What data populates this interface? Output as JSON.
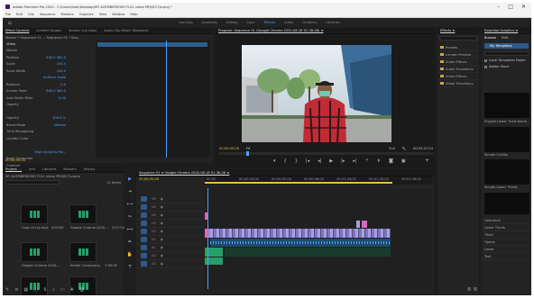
{
  "app": {
    "title": "Adobe Premiere Pro 2020 - C:\\Users\\User\\Desktop\\MY ACEMBERSOKO FULL video PROJECT.prproj *",
    "win_buttons": [
      "–",
      "□",
      "✕"
    ]
  },
  "menu": [
    "File",
    "Edit",
    "Clip",
    "Sequence",
    "Markers",
    "Graphics",
    "View",
    "Window",
    "Help"
  ],
  "workspaces": [
    "Learning",
    "Assembly",
    "Editing",
    "Color",
    "Effects",
    "Audio",
    "Graphics",
    "Libraries"
  ],
  "workspace_active": 4,
  "effect_controls": {
    "tabs": [
      "Effect Controls",
      "Lumetri Scopes",
      "Source: (no clips)",
      "Audio Clip Mixer: Sequence"
    ],
    "master": "Master * Sequence 01 ... Sequence 01 * Seq...",
    "clip_label": "Video",
    "rows": [
      {
        "label": "Motion",
        "value": ""
      },
      {
        "label": "Position",
        "value": "640.0  360.0"
      },
      {
        "label": "Scale",
        "value": "100.0"
      },
      {
        "label": "Scale Width",
        "value": "100.0"
      },
      {
        "label": "",
        "value": "Uniform Scale"
      },
      {
        "label": "Rotation",
        "value": "0.0"
      },
      {
        "label": "Anchor Point",
        "value": "640.0  360.0"
      },
      {
        "label": "Anti-flicker Filter",
        "value": "0.00"
      },
      {
        "label": "Opacity",
        "value": ""
      },
      {
        "label": "",
        "value": ""
      },
      {
        "label": "Opacity",
        "value": "100.0 %"
      },
      {
        "label": "Blend Mode",
        "value": "Normal"
      },
      {
        "label": "Time Remapping",
        "value": ""
      },
      {
        "label": "Lumetri Color",
        "value": ""
      },
      {
        "label": "",
        "value": ""
      },
      {
        "label": "",
        "value": "High Dynamic Ra..."
      },
      {
        "label": "Basic Correction",
        "value": ""
      },
      {
        "label": "Creative",
        "value": ""
      },
      {
        "label": "Curves",
        "value": ""
      }
    ],
    "timecode": "00;00;00;00"
  },
  "program": {
    "title": "Program: Sequence 01 (Google Chrome 2020-08-18 01-36-08) ≡",
    "timecode": "00;00;05;28",
    "fit": "Fit",
    "quality": "Full",
    "duration": "00;03;27;24",
    "controls": [
      "marker",
      "in",
      "out",
      "go-in",
      "step-back",
      "play",
      "step-fwd",
      "go-out",
      "lift",
      "extract",
      "export-frame",
      "settings"
    ]
  },
  "project": {
    "tabs": [
      "Project: ...",
      "Info",
      "Libraries",
      "Markers",
      "History"
    ],
    "active_tab": 0,
    "path": "MY ACEMBERSOKO FULL video PROJECT.prproj",
    "count": "22 Items",
    "items": [
      {
        "name": "Copy of Lily.mp4",
        "dur": "5:00:00"
      },
      {
        "name": "Google Chrome 2020-...",
        "dur": "3:27:24"
      },
      {
        "name": "Google Chrome 2020-...",
        "dur": ""
      },
      {
        "name": "Action Conspiracy...",
        "dur": "3:00:00"
      },
      {
        "name": "MPA4_google_...",
        "dur": "3:37:31"
      },
      {
        "name": "",
        "dur": ""
      }
    ]
  },
  "timeline": {
    "title": "Sequence 01 ≡ Google Chrome 2020-08-18 01-36-08  ≡",
    "timecode": "00;00;05;28",
    "ruler": [
      "00;00",
      "00;00;16;00",
      "00;00;32;00",
      "00;00;48;00",
      "00;01;04;02",
      "00;01;20;02",
      "00;01;36;02"
    ],
    "tracks": [
      "V6",
      "V5",
      "V4",
      "V3",
      "V2",
      "V1",
      "A1",
      "A2",
      "A3"
    ]
  },
  "tools": [
    "selection",
    "track-select",
    "ripple",
    "razor",
    "slip",
    "pen",
    "hand",
    "type"
  ],
  "effects": {
    "title": "Effects ≡",
    "search": "",
    "items": [
      "Presets",
      "Lumetri Presets",
      "Audio Effects",
      "Audio Transitions",
      "Video Effects",
      "Video Transitions"
    ]
  },
  "essential": {
    "title": "Essential Graphics ≡",
    "tabs": [
      "Browse",
      "Edit"
    ],
    "section": "My Templates",
    "local_label": "Local Templates Folder",
    "adobe_label": "Adobe Stock",
    "templates": [
      "English Lower Third Name",
      "Simple Credits",
      "Simple Lower Thirds"
    ],
    "list": [
      "Operators",
      "Lower Thirds",
      "Titles",
      "Opens",
      "Lower",
      "Text"
    ]
  },
  "colors": {
    "accent": "#4fa3ff",
    "timecode": "#e6c234",
    "audio": "#25a06a",
    "video": "#a9a0e0",
    "pink": "#d56ab8",
    "jacket": "#c22b35"
  }
}
